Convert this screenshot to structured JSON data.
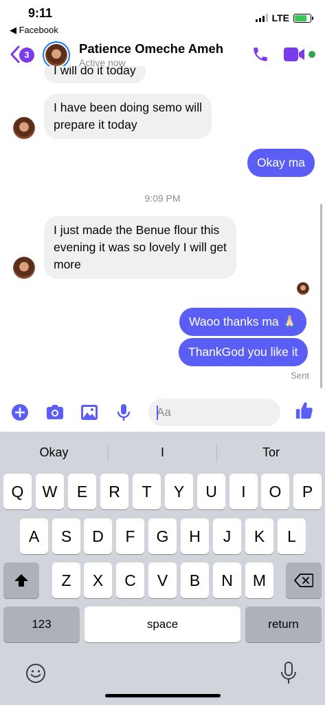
{
  "status_bar": {
    "time": "9:11",
    "back_app": "◀ Facebook",
    "network": "LTE"
  },
  "header": {
    "unread_count": "3",
    "contact_name": "Patience Omeche Ameh",
    "contact_status": "Active now",
    "accent_color": "#7c3aed"
  },
  "messages": [
    {
      "from": "contact",
      "text": "I will do it today"
    },
    {
      "from": "contact",
      "lines": [
        "I have been doing semo will",
        "prepare it today"
      ]
    },
    {
      "from": "me",
      "text": "Okay ma"
    },
    {
      "timestamp": "9:09 PM"
    },
    {
      "from": "contact",
      "lines": [
        "I just made the Benue flour this",
        "evening it was so lovely I will get",
        "more"
      ]
    },
    {
      "from": "me",
      "text": "Waoo thanks ma 🙏🏻"
    },
    {
      "from": "me",
      "text": "ThankGod you like it"
    },
    {
      "status": "Sent"
    }
  ],
  "composer": {
    "placeholder": "Aa"
  },
  "keyboard": {
    "suggestions": [
      "Okay",
      "I",
      "Tor"
    ],
    "row1": [
      "Q",
      "W",
      "E",
      "R",
      "T",
      "Y",
      "U",
      "I",
      "O",
      "P"
    ],
    "row2": [
      "A",
      "S",
      "D",
      "F",
      "G",
      "H",
      "J",
      "K",
      "L"
    ],
    "row3": [
      "Z",
      "X",
      "C",
      "V",
      "B",
      "N",
      "M"
    ],
    "numbers_key": "123",
    "space_key": "space",
    "return_key": "return"
  },
  "icons": [
    "back-chevron-icon",
    "phone-icon",
    "video-icon",
    "plus-icon",
    "camera-icon",
    "gallery-icon",
    "microphone-icon",
    "emoji-icon",
    "thumbs-up-icon",
    "shift-icon",
    "backspace-icon",
    "keyboard-emoji-icon",
    "dictation-icon"
  ],
  "colors": {
    "outgoing_bubble": "#5b5ef4",
    "incoming_bubble": "#f0f0f0",
    "messenger_blue": "#1877f2",
    "online_green": "#31a24c"
  }
}
